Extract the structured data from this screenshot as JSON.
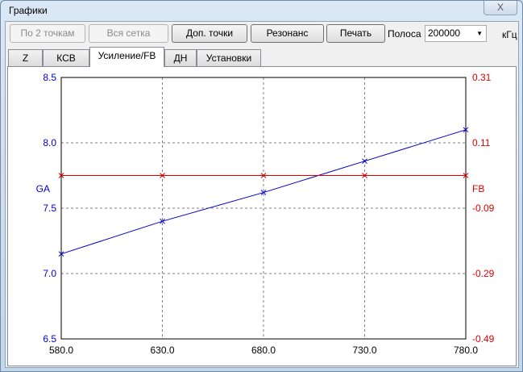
{
  "window": {
    "title": "Графики",
    "close": "X"
  },
  "toolbar": {
    "by2": "По 2 точкам",
    "grid": "Вся сетка",
    "extra": "Доп. точки",
    "resonance": "Резонанс",
    "print": "Печать",
    "band_label": "Полоса",
    "band_value": "200000",
    "unit": "кГц"
  },
  "tabs": [
    "Z",
    "КСВ",
    "Усиление/FB",
    "ДН",
    "Установки"
  ],
  "colors": {
    "ga": "#0000cc",
    "fb": "#dd0000",
    "grid": "#808080"
  },
  "chart_data": {
    "type": "line",
    "x": [
      580,
      630,
      680,
      730,
      780
    ],
    "xticks": [
      "580.0",
      "630.0",
      "680.0",
      "730.0",
      "780.0"
    ],
    "xlim": [
      580,
      780
    ],
    "series": [
      {
        "name": "GA",
        "axis": "left",
        "values": [
          7.15,
          7.4,
          7.62,
          7.86,
          8.1
        ]
      },
      {
        "name": "FB",
        "axis": "right",
        "values": [
          0.01,
          0.01,
          0.01,
          0.01,
          0.01
        ]
      }
    ],
    "ylim_left": [
      6.5,
      8.5
    ],
    "yticks_left": [
      "8.5",
      "8.0",
      "7.5",
      "7.0",
      "6.5"
    ],
    "ylim_right": [
      -0.49,
      0.31
    ],
    "yticks_right": [
      "0.31",
      "0.11",
      "-0.09",
      "-0.29",
      "-0.49"
    ],
    "ylabel_left": "GA",
    "ylabel_right": "FB",
    "grid": true
  }
}
